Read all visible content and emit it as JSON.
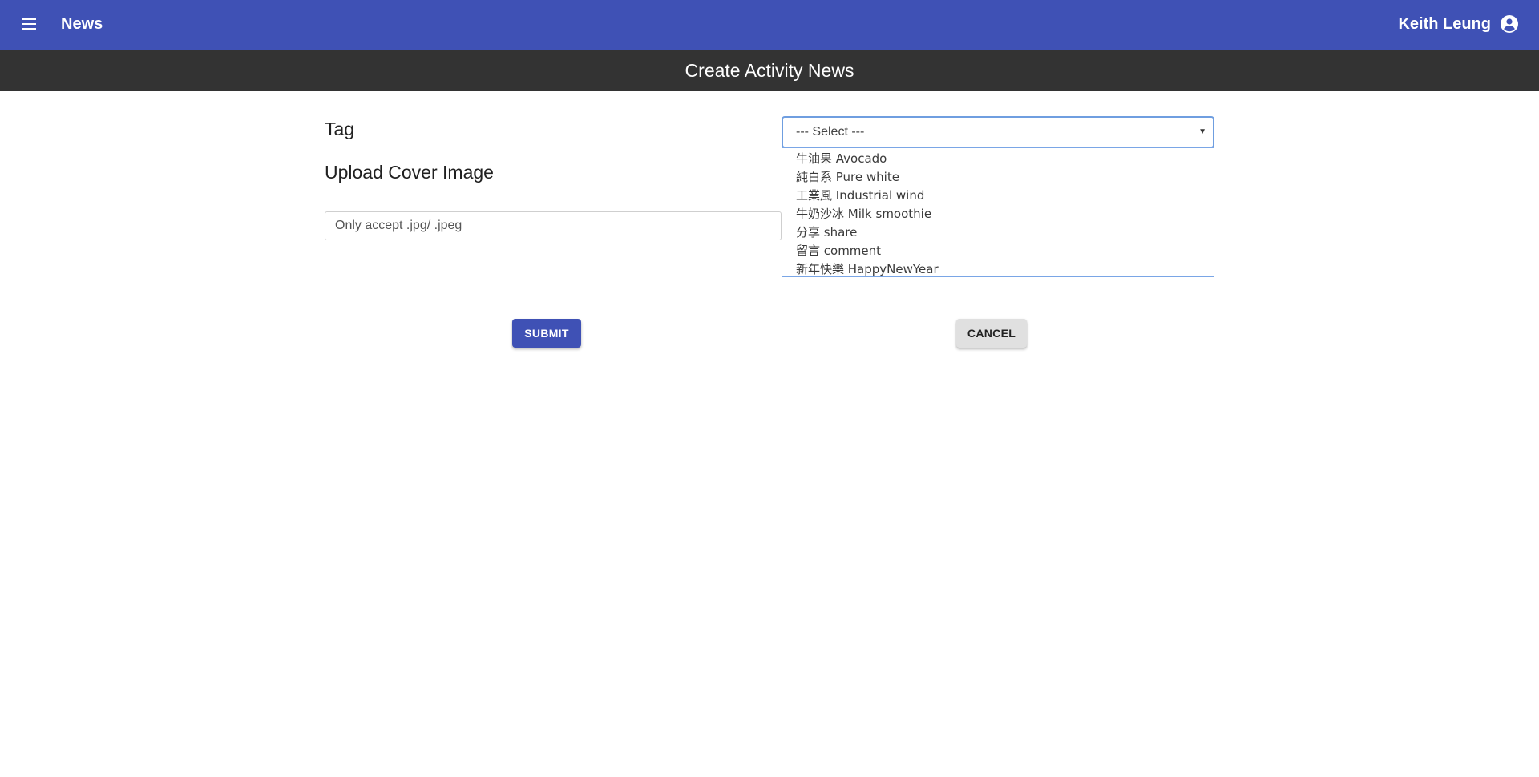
{
  "appbar": {
    "title": "News",
    "user_name": "Keith Leung",
    "menu_icon": "menu-icon",
    "account_icon": "account-circle-icon",
    "color": "#3f51b5"
  },
  "subbar": {
    "title": "Create Activity News",
    "color": "#333333"
  },
  "form": {
    "tag_label": "Tag",
    "upload_label": "Upload Cover Image",
    "file_placeholder": "Only accept .jpg/ .jpeg",
    "tag_select": {
      "selected": "--- Select ---",
      "options": [
        "牛油果 Avocado",
        "純白系 Pure white",
        "工業風 Industrial wind",
        "牛奶沙冰 Milk smoothie",
        "分享 share",
        "留言 comment",
        "新年快樂 HappyNewYear"
      ]
    }
  },
  "actions": {
    "submit_label": "SUBMIT",
    "cancel_label": "CANCEL"
  }
}
